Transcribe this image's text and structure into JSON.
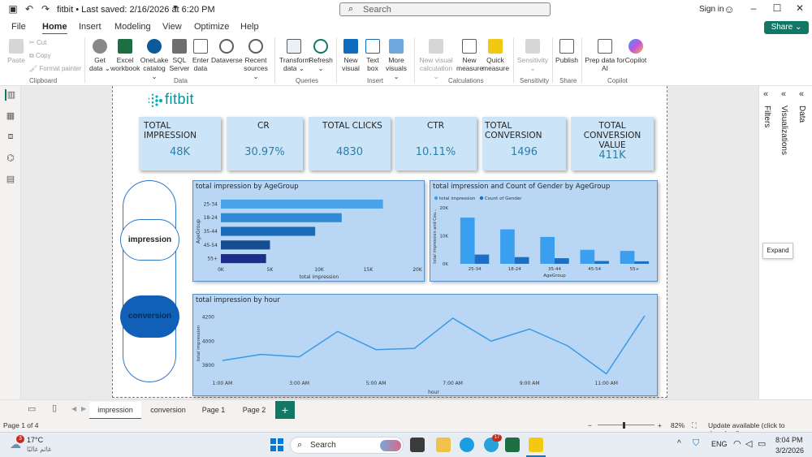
{
  "titlebar": {
    "doc_title": "fitbit • Last saved: 2/16/2026 at 6:20 PM",
    "search_placeholder": "Search",
    "signin": "Sign in"
  },
  "menu": {
    "items": [
      "File",
      "Home",
      "Insert",
      "Modeling",
      "View",
      "Optimize",
      "Help"
    ],
    "active": "Home",
    "share": "Share"
  },
  "ribbon": {
    "clipboard": {
      "paste": "Paste",
      "cut": "Cut",
      "copy": "Copy",
      "format_painter": "Format painter",
      "group": "Clipboard"
    },
    "data": {
      "get_data": [
        "Get",
        "data ⌄"
      ],
      "excel": [
        "Excel",
        "workbook"
      ],
      "onelake": [
        "OneLake",
        "catalog ⌄"
      ],
      "sql": [
        "SQL",
        "Server"
      ],
      "enter": [
        "Enter",
        "data"
      ],
      "dataverse": [
        "Dataverse",
        ""
      ],
      "recent": [
        "Recent",
        "sources ⌄"
      ],
      "group": "Data"
    },
    "queries": {
      "transform": [
        "Transform",
        "data ⌄"
      ],
      "refresh": [
        "Refresh",
        "⌄"
      ],
      "group": "Queries"
    },
    "insert": {
      "new_visual": [
        "New",
        "visual"
      ],
      "text_box": [
        "Text",
        "box"
      ],
      "more_visuals": [
        "More",
        "visuals ⌄"
      ],
      "group": "Insert"
    },
    "calculations": {
      "new_visual_calc": [
        "New visual",
        "calculation ⌄"
      ],
      "new_measure": [
        "New",
        "measure"
      ],
      "quick_measure": [
        "Quick",
        "measure"
      ],
      "group": "Calculations"
    },
    "sensitivity": {
      "label": [
        "Sensitivity",
        "⌄"
      ],
      "group": "Sensitivity"
    },
    "share": {
      "publish": [
        "Publish",
        ""
      ],
      "group": "Share"
    },
    "copilot": {
      "prep": [
        "Prep data for",
        "AI"
      ],
      "copilot": [
        "Copilot",
        ""
      ],
      "group": "Copilot"
    }
  },
  "report": {
    "logo_text": "fitbit",
    "kpis": [
      {
        "label": "TOTAL IMPRESSION",
        "value": "48K"
      },
      {
        "label": "CR",
        "value": "30.97%"
      },
      {
        "label": "TOTAL CLICKS",
        "value": "4830"
      },
      {
        "label": "CTR",
        "value": "10.11%"
      },
      {
        "label": "TOTAL CONVERSION",
        "value": "1496"
      },
      {
        "label": "TOTAL CONVERSION VALUE",
        "value": "411K"
      }
    ],
    "nav_buttons": {
      "impression": "impression",
      "conversion": "conversion"
    }
  },
  "chart_data": [
    {
      "type": "bar",
      "orientation": "horizontal",
      "title": "total impression by AgeGroup",
      "xlabel": "total impression",
      "ylabel": "AgeGroup",
      "categories": [
        "25-34",
        "18-24",
        "35-44",
        "45-54",
        "55+"
      ],
      "values": [
        16500,
        12300,
        9600,
        5000,
        4600
      ],
      "xticks": [
        "0K",
        "5K",
        "10K",
        "15K",
        "20K"
      ],
      "xlim": [
        0,
        20000
      ],
      "colors": [
        "#4aa3e8",
        "#2f8ad8",
        "#1a6cb8",
        "#174e91",
        "#1b2f8a"
      ]
    },
    {
      "type": "bar",
      "title": "total impression and Count of Gender by AgeGroup",
      "xlabel": "AgeGroup",
      "ylabel": "total impression and Cou...",
      "categories": [
        "25-34",
        "18-24",
        "35-44",
        "45-54",
        "55+"
      ],
      "series": [
        {
          "name": "total impression",
          "values": [
            16500,
            12300,
            9600,
            5000,
            4600
          ],
          "color": "#3b9ff0"
        },
        {
          "name": "Count of Gender",
          "values": [
            3300,
            2400,
            2000,
            1000,
            900
          ],
          "color": "#1d6fc4"
        }
      ],
      "yticks": [
        "0K",
        "10K",
        "20K"
      ],
      "ylim": [
        0,
        20000
      ],
      "legend": "top-left"
    },
    {
      "type": "line",
      "title": "total impression by hour",
      "xlabel": "hour",
      "ylabel": "total impression",
      "x": [
        "1:00 AM",
        "2:00 AM",
        "3:00 AM",
        "4:00 AM",
        "5:00 AM",
        "6:00 AM",
        "7:00 AM",
        "8:00 AM",
        "9:00 AM",
        "10:00 AM",
        "11:00 AM",
        "12:00 PM"
      ],
      "values": [
        3840,
        3890,
        3870,
        4080,
        3930,
        3940,
        4190,
        4000,
        4100,
        3960,
        3730,
        4210
      ],
      "xticks": [
        "1:00 AM",
        "3:00 AM",
        "5:00 AM",
        "7:00 AM",
        "9:00 AM",
        "11:00 AM"
      ],
      "yticks": [
        "3800",
        "4000",
        "4200"
      ],
      "ylim": [
        3700,
        4250
      ],
      "color": "#3a9ae8"
    }
  ],
  "right_panes": {
    "filters": "Filters",
    "visualizations": "Visualizations",
    "data": "Data",
    "expand": "Expand"
  },
  "tabs": {
    "items": [
      "impression",
      "conversion",
      "Page 1",
      "Page 2"
    ],
    "active": "impression",
    "add": "+"
  },
  "status": {
    "page": "Page 1 of 4",
    "zoom": "82%",
    "update": "Update available (click to download)"
  },
  "taskbar": {
    "weather_temp": "17°C",
    "weather_desc": "غائم غالبًا",
    "search": "Search",
    "lang": "ENG",
    "time": "8:04 PM",
    "date": "3/2/2026",
    "weather_badge": "3",
    "app_badge": "17"
  }
}
